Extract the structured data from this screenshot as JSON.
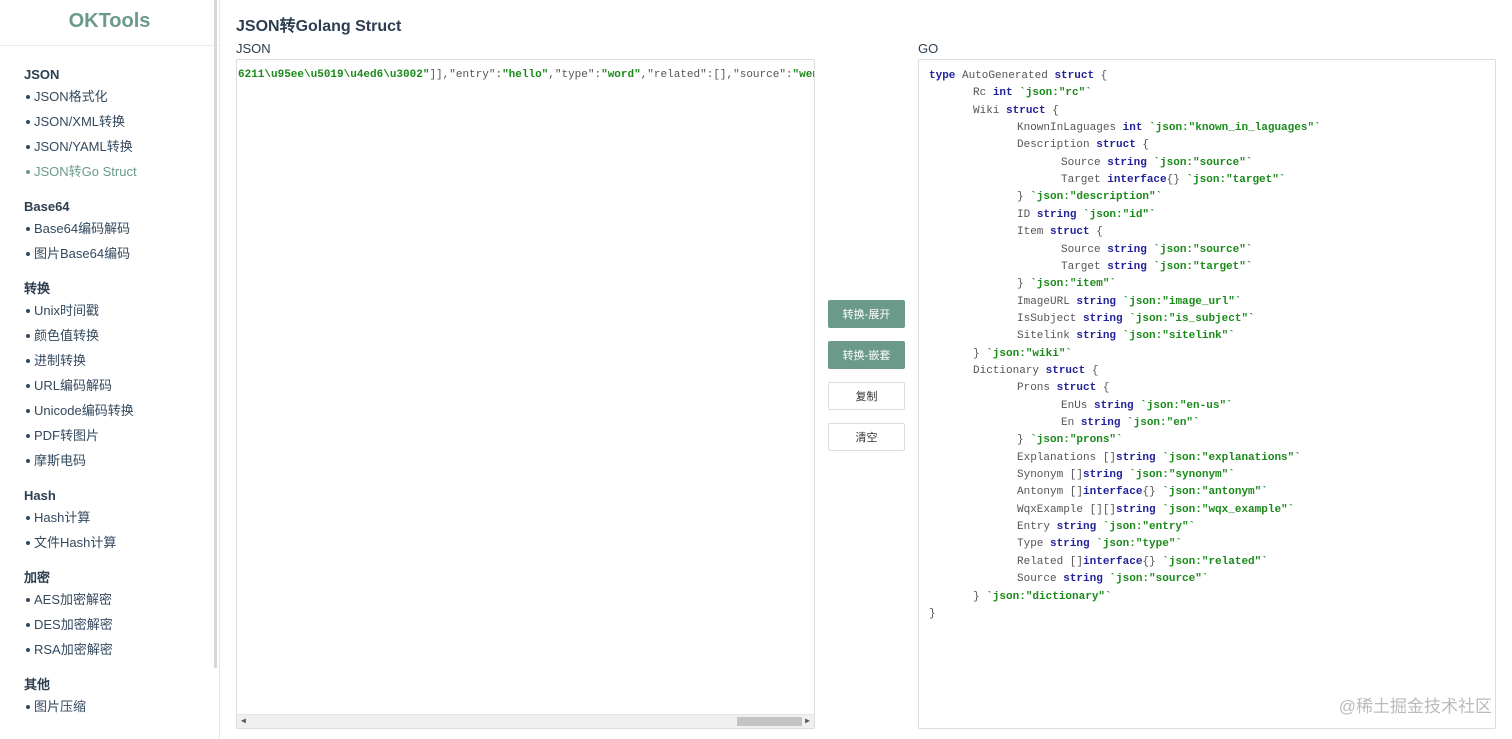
{
  "sidebar": {
    "logo": "OKTools",
    "sections": [
      {
        "title": "JSON",
        "items": [
          "JSON格式化",
          "JSON/XML转换",
          "JSON/YAML转换",
          "JSON转Go Struct"
        ]
      },
      {
        "title": "Base64",
        "items": [
          "Base64编码解码",
          "图片Base64编码"
        ]
      },
      {
        "title": "转换",
        "items": [
          "Unix时间戳",
          "颜色值转换",
          "进制转换",
          "URL编码解码",
          "Unicode编码转换",
          "PDF转图片",
          "摩斯电码"
        ]
      },
      {
        "title": "Hash",
        "items": [
          "Hash计算",
          "文件Hash计算"
        ]
      },
      {
        "title": "加密",
        "items": [
          "AES加密解密",
          "DES加密解密",
          "RSA加密解密"
        ]
      },
      {
        "title": "其他",
        "items": [
          "图片压缩"
        ]
      }
    ],
    "active": "JSON转Go Struct"
  },
  "page": {
    "title": "JSON转Golang Struct",
    "json_label": "JSON",
    "go_label": "GO"
  },
  "json_input": [
    [
      "g",
      "6211\\u95ee\\u5019\\u4ed6\\u3002\""
    ],
    [
      "p",
      "]],\"entry\":"
    ],
    [
      "g",
      "\"hello\""
    ],
    [
      "p",
      ",\"type\":"
    ],
    [
      "g",
      "\"word\""
    ],
    [
      "p",
      ",\"related\":[],\"source\":"
    ],
    [
      "g",
      "\"wenquxing\""
    ],
    [
      "p",
      "}"
    ]
  ],
  "buttons": {
    "convert_expand": "转换-展开",
    "convert_nested": "转换-嵌套",
    "copy": "复制",
    "clear": "清空"
  },
  "go_output": [
    [
      0,
      [
        [
          "k",
          "type"
        ],
        [
          "p",
          " AutoGenerated "
        ],
        [
          "k",
          "struct"
        ],
        [
          "p",
          " {"
        ]
      ]
    ],
    [
      1,
      [
        [
          "p",
          "Rc "
        ],
        [
          "k",
          "int"
        ],
        [
          "g",
          " `json:\"rc\"`"
        ]
      ]
    ],
    [
      1,
      [
        [
          "p",
          "Wiki "
        ],
        [
          "k",
          "struct"
        ],
        [
          "p",
          " {"
        ]
      ]
    ],
    [
      2,
      [
        [
          "p",
          "KnownInLaguages "
        ],
        [
          "k",
          "int"
        ],
        [
          "g",
          " `json:\"known_in_laguages\"`"
        ]
      ]
    ],
    [
      2,
      [
        [
          "p",
          "Description "
        ],
        [
          "k",
          "struct"
        ],
        [
          "p",
          " {"
        ]
      ]
    ],
    [
      3,
      [
        [
          "p",
          "Source "
        ],
        [
          "k",
          "string"
        ],
        [
          "g",
          " `json:\"source\"`"
        ]
      ]
    ],
    [
      3,
      [
        [
          "p",
          "Target "
        ],
        [
          "k",
          "interface"
        ],
        [
          "p",
          "{}"
        ],
        [
          "g",
          " `json:\"target\"`"
        ]
      ]
    ],
    [
      2,
      [
        [
          "p",
          "}"
        ],
        [
          "g",
          " `json:\"description\"`"
        ]
      ]
    ],
    [
      2,
      [
        [
          "p",
          "ID "
        ],
        [
          "k",
          "string"
        ],
        [
          "g",
          " `json:\"id\"`"
        ]
      ]
    ],
    [
      2,
      [
        [
          "p",
          "Item "
        ],
        [
          "k",
          "struct"
        ],
        [
          "p",
          " {"
        ]
      ]
    ],
    [
      3,
      [
        [
          "p",
          "Source "
        ],
        [
          "k",
          "string"
        ],
        [
          "g",
          " `json:\"source\"`"
        ]
      ]
    ],
    [
      3,
      [
        [
          "p",
          "Target "
        ],
        [
          "k",
          "string"
        ],
        [
          "g",
          " `json:\"target\"`"
        ]
      ]
    ],
    [
      2,
      [
        [
          "p",
          "}"
        ],
        [
          "g",
          " `json:\"item\"`"
        ]
      ]
    ],
    [
      2,
      [
        [
          "p",
          "ImageURL "
        ],
        [
          "k",
          "string"
        ],
        [
          "g",
          " `json:\"image_url\"`"
        ]
      ]
    ],
    [
      2,
      [
        [
          "p",
          "IsSubject "
        ],
        [
          "k",
          "string"
        ],
        [
          "g",
          " `json:\"is_subject\"`"
        ]
      ]
    ],
    [
      2,
      [
        [
          "p",
          "Sitelink "
        ],
        [
          "k",
          "string"
        ],
        [
          "g",
          " `json:\"sitelink\"`"
        ]
      ]
    ],
    [
      1,
      [
        [
          "p",
          "}"
        ],
        [
          "g",
          " `json:\"wiki\"`"
        ]
      ]
    ],
    [
      1,
      [
        [
          "p",
          "Dictionary "
        ],
        [
          "k",
          "struct"
        ],
        [
          "p",
          " {"
        ]
      ]
    ],
    [
      2,
      [
        [
          "p",
          "Prons "
        ],
        [
          "k",
          "struct"
        ],
        [
          "p",
          " {"
        ]
      ]
    ],
    [
      3,
      [
        [
          "p",
          "EnUs "
        ],
        [
          "k",
          "string"
        ],
        [
          "g",
          " `json:\"en-us\"`"
        ]
      ]
    ],
    [
      3,
      [
        [
          "p",
          "En "
        ],
        [
          "k",
          "string"
        ],
        [
          "g",
          " `json:\"en\"`"
        ]
      ]
    ],
    [
      2,
      [
        [
          "p",
          "}"
        ],
        [
          "g",
          " `json:\"prons\"`"
        ]
      ]
    ],
    [
      2,
      [
        [
          "p",
          "Explanations []"
        ],
        [
          "k",
          "string"
        ],
        [
          "g",
          " `json:\"explanations\"`"
        ]
      ]
    ],
    [
      2,
      [
        [
          "p",
          "Synonym []"
        ],
        [
          "k",
          "string"
        ],
        [
          "g",
          " `json:\"synonym\"`"
        ]
      ]
    ],
    [
      2,
      [
        [
          "p",
          "Antonym []"
        ],
        [
          "k",
          "interface"
        ],
        [
          "p",
          "{}"
        ],
        [
          "g",
          " `json:\"antonym\"`"
        ]
      ]
    ],
    [
      2,
      [
        [
          "p",
          "WqxExample [][]"
        ],
        [
          "k",
          "string"
        ],
        [
          "g",
          " `json:\"wqx_example\"`"
        ]
      ]
    ],
    [
      2,
      [
        [
          "p",
          "Entry "
        ],
        [
          "k",
          "string"
        ],
        [
          "g",
          " `json:\"entry\"`"
        ]
      ]
    ],
    [
      2,
      [
        [
          "p",
          "Type "
        ],
        [
          "k",
          "string"
        ],
        [
          "g",
          " `json:\"type\"`"
        ]
      ]
    ],
    [
      2,
      [
        [
          "p",
          "Related []"
        ],
        [
          "k",
          "interface"
        ],
        [
          "p",
          "{}"
        ],
        [
          "g",
          " `json:\"related\"`"
        ]
      ]
    ],
    [
      2,
      [
        [
          "p",
          "Source "
        ],
        [
          "k",
          "string"
        ],
        [
          "g",
          " `json:\"source\"`"
        ]
      ]
    ],
    [
      1,
      [
        [
          "p",
          "}"
        ],
        [
          "g",
          " `json:\"dictionary\"`"
        ]
      ]
    ],
    [
      0,
      [
        [
          "p",
          "}"
        ]
      ]
    ]
  ],
  "watermark": "@稀土掘金技术社区"
}
